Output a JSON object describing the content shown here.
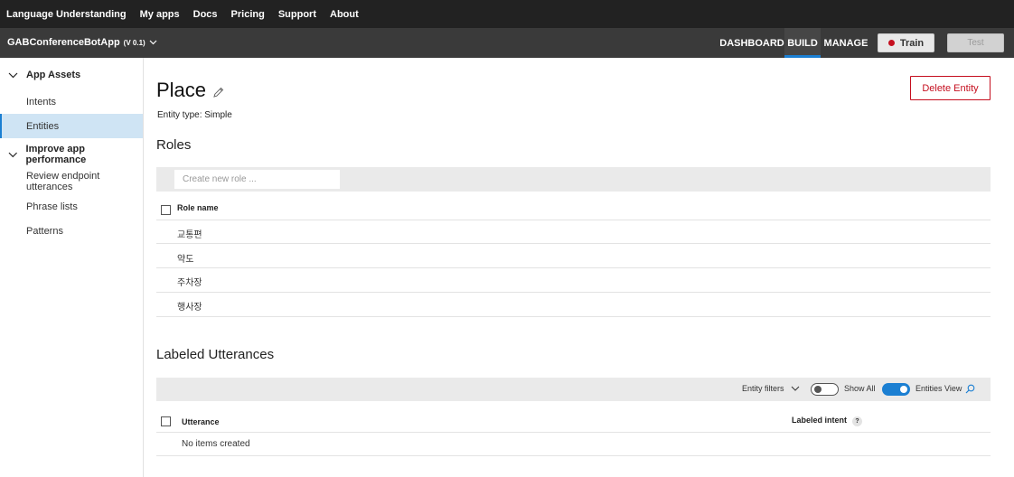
{
  "topnav": {
    "items": [
      "Language Understanding",
      "My apps",
      "Docs",
      "Pricing",
      "Support",
      "About"
    ]
  },
  "appbar": {
    "app_name": "GABConferenceBotApp",
    "version": "(V 0.1)",
    "tabs": [
      "DASHBOARD",
      "BUILD",
      "MANAGE"
    ],
    "active_tab": "BUILD",
    "train_label": "Train",
    "test_label": "Test"
  },
  "sidebar": {
    "groups": [
      {
        "label": "App Assets",
        "items": [
          "Intents",
          "Entities"
        ]
      },
      {
        "label": "Improve app performance",
        "items": [
          "Review endpoint utterances",
          "Phrase lists",
          "Patterns"
        ]
      }
    ],
    "active_item": "Entities"
  },
  "main": {
    "title": "Place",
    "entity_type": "Entity type: Simple",
    "delete_label": "Delete Entity",
    "roles": {
      "title": "Roles",
      "placeholder": "Create new role ...",
      "column": "Role name",
      "rows": [
        "교통편",
        "약도",
        "주차장",
        "행사장"
      ]
    },
    "utterances": {
      "title": "Labeled Utterances",
      "entity_filters": "Entity filters",
      "show_all": "Show All",
      "show_all_on": false,
      "entities_view": "Entities View",
      "entities_view_on": true,
      "col_utterance": "Utterance",
      "col_intent": "Labeled intent",
      "help": "?",
      "empty": "No items created"
    }
  },
  "colors": {
    "accent": "#1b7fd2",
    "danger": "#c50f1f",
    "topnav_bg": "#222222",
    "appbar_bg": "#3a3a3a",
    "active_sidebar_bg": "#cfe4f4"
  }
}
